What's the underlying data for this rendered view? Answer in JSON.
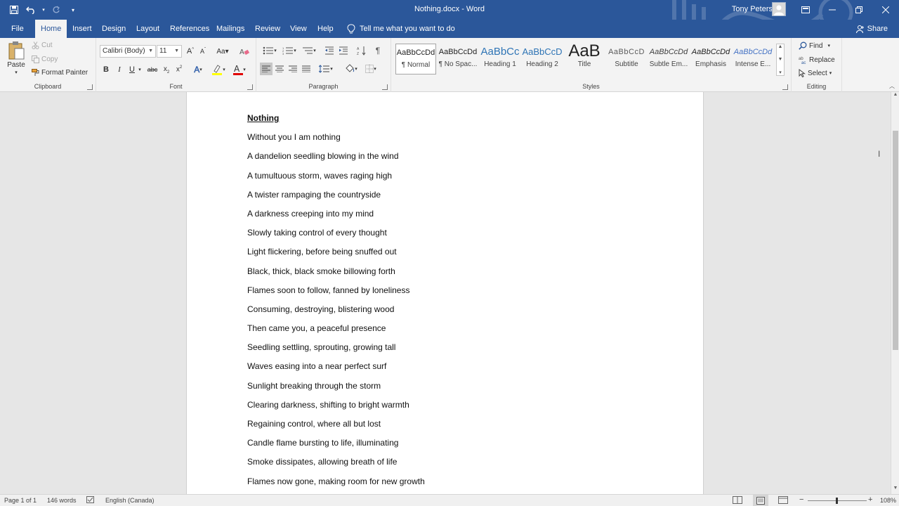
{
  "window": {
    "title": "Nothing.docx - Word",
    "user_name": "Tony Peters"
  },
  "tabs": [
    {
      "label": "File"
    },
    {
      "label": "Home"
    },
    {
      "label": "Insert"
    },
    {
      "label": "Design"
    },
    {
      "label": "Layout"
    },
    {
      "label": "References"
    },
    {
      "label": "Mailings"
    },
    {
      "label": "Review"
    },
    {
      "label": "View"
    },
    {
      "label": "Help"
    }
  ],
  "tell_me": "Tell me what you want to do",
  "share_label": "Share",
  "clipboard": {
    "group_label": "Clipboard",
    "paste": "Paste",
    "cut": "Cut",
    "copy": "Copy",
    "format_painter": "Format Painter"
  },
  "font": {
    "group_label": "Font",
    "font_name": "Calibri (Body)",
    "font_size": "11",
    "font_color": "#e00000",
    "highlight_color": "#ffff00"
  },
  "paragraph": {
    "group_label": "Paragraph"
  },
  "styles": {
    "group_label": "Styles",
    "items": [
      {
        "sample": "AaBbCcDd",
        "name": "¶ Normal"
      },
      {
        "sample": "AaBbCcDd",
        "name": "¶ No Spac..."
      },
      {
        "sample": "AaBbCc",
        "name": "Heading 1"
      },
      {
        "sample": "AaBbCcD",
        "name": "Heading 2"
      },
      {
        "sample": "AaB",
        "name": "Title"
      },
      {
        "sample": "AaBbCcD",
        "name": "Subtitle"
      },
      {
        "sample": "AaBbCcDd",
        "name": "Subtle Em..."
      },
      {
        "sample": "AaBbCcDd",
        "name": "Emphasis"
      },
      {
        "sample": "AaBbCcDd",
        "name": "Intense E..."
      }
    ]
  },
  "editing": {
    "group_label": "Editing",
    "find": "Find",
    "replace": "Replace",
    "select": "Select"
  },
  "document": {
    "heading": "Nothing",
    "lines": [
      "Without you I am nothing",
      "A dandelion seedling blowing in the wind",
      "A tumultuous storm, waves raging high",
      "A twister rampaging the countryside",
      "A darkness creeping into my mind",
      "Slowly taking control of every thought",
      "Light flickering, before being snuffed out",
      "Black, thick, black smoke billowing forth",
      "Flames soon to follow, fanned by loneliness",
      "Consuming, destroying, blistering wood",
      "Then came you, a peaceful presence",
      "Seedling settling, sprouting, growing tall",
      "Waves easing into a near perfect surf",
      "Sunlight breaking through the storm",
      "Clearing darkness, shifting to bright warmth",
      "Regaining control, where all but lost",
      "Candle flame bursting to life, illuminating",
      "Smoke dissipates, allowing breath of life",
      "Flames now gone, making room for new growth"
    ]
  },
  "status": {
    "page": "Page 1 of 1",
    "words": "146 words",
    "language": "English (Canada)",
    "zoom": "108%"
  },
  "colors": {
    "accent": "#2b579a"
  }
}
